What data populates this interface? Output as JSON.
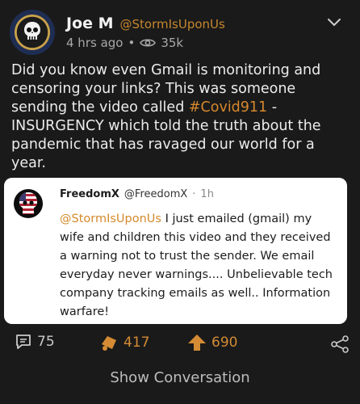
{
  "post": {
    "author_name": "Joe M",
    "author_handle": "@StormIsUponUs",
    "time": "4 hrs ago",
    "separator": "•",
    "views": "35k",
    "body_text_before": "Did you know even Gmail is monitoring and censoring your links? This was someone sending the video called ",
    "hashtag": "#Covid911",
    "body_text_after": " - INSURGENCY which told the truth about the pandemic that has ravaged our world for a year."
  },
  "quote": {
    "author_name": "FreedomX",
    "author_handle": "@FreedomX",
    "separator": "·",
    "time": "1h",
    "mention": "@StormIsUponUs",
    "text": " I just emailed (gmail) my wife and children this video and they received a warning not to trust the sender. We email everyday never warnings.... Unbelievable tech company tracking emails as well.. Information warfare!"
  },
  "actions": {
    "replies": "75",
    "dislikes": "417",
    "upvotes": "690"
  },
  "footer": {
    "show_conversation": "Show Conversation"
  },
  "icons": {
    "chevron": "chevron-down-icon",
    "views": "eye-icon",
    "replies": "comment-icon",
    "dislikes": "dislike-icon",
    "upvotes": "upvote-arrow-icon",
    "share": "share-icon"
  },
  "colors": {
    "background": "#1a1a1a",
    "accent": "#d48b34",
    "quote_background": "#ffffff"
  }
}
